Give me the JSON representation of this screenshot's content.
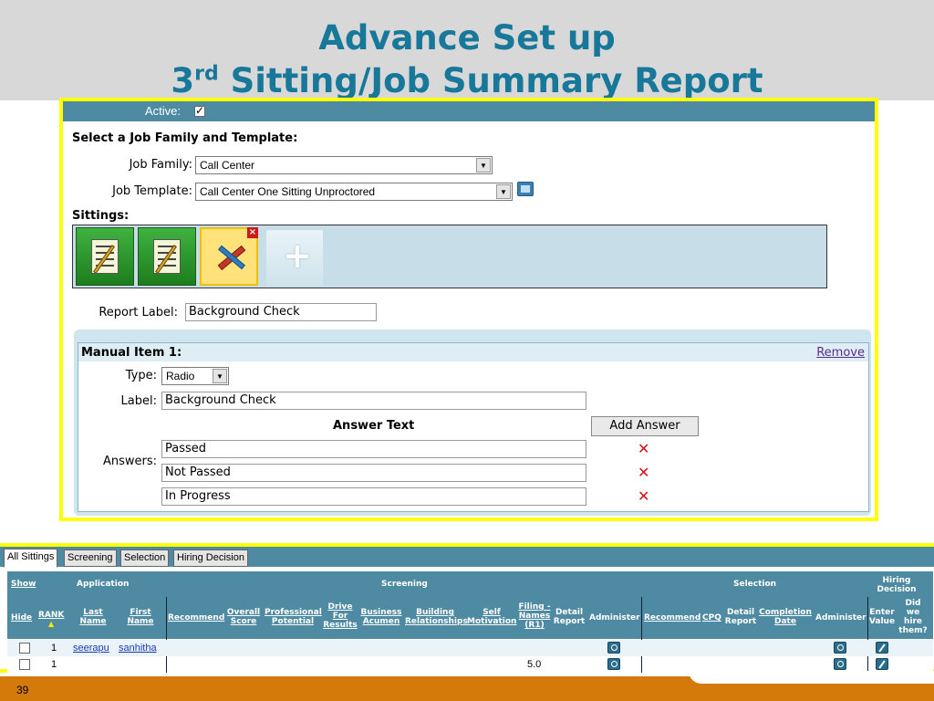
{
  "slide": {
    "title_line1": "Advance Set up",
    "title_line2_num": "3",
    "title_line2_sup": "rd",
    "title_line2_rest": " Sitting/Job Summary Report",
    "page_number": "39"
  },
  "setup": {
    "active_label": "Active:",
    "active_checked": true,
    "select_heading": "Select a Job Family and Template:",
    "job_family_label": "Job Family:",
    "job_family_value": "Call Center",
    "job_template_label": "Job Template:",
    "job_template_value": "Call Center One Sitting Unproctored",
    "sittings_label": "Sittings:",
    "report_label_label": "Report Label:",
    "report_label_value": "Background Check"
  },
  "sittings": [
    {
      "icon": "checklist-icon",
      "selected": false
    },
    {
      "icon": "checklist-icon",
      "selected": false
    },
    {
      "icon": "tools-icon",
      "selected": true
    },
    {
      "icon": "add-icon",
      "selected": false
    }
  ],
  "manual_item": {
    "heading": "Manual Item 1:",
    "remove": "Remove",
    "type_label": "Type:",
    "type_value": "Radio",
    "label_label": "Label:",
    "label_value": "Background Check",
    "answer_text_header": "Answer Text",
    "add_answer": "Add Answer",
    "answers_label": "Answers:",
    "answers": [
      "Passed",
      "Not Passed",
      "In Progress"
    ]
  },
  "grid": {
    "tabs": [
      "All Sittings",
      "Screening",
      "Selection",
      "Hiring Decision"
    ],
    "groups": {
      "show": "Show",
      "application": "Application",
      "screening": "Screening",
      "selection": "Selection",
      "hiring": "Hiring Decision"
    },
    "columns": {
      "hide": "Hide",
      "rank": "RANK",
      "last_name": "Last Name",
      "first_name": "First Name",
      "recommend": "Recommend",
      "overall_score": "Overall Score",
      "professional_potential": "Professional Potential",
      "drive_for_results": "Drive For Results",
      "business_acumen": "Business Acumen",
      "building_relationships": "Building Relationships",
      "self_motivation": "Self Motivation",
      "filing_names": "Filing - Names (R1)",
      "detail_report": "Detail Report",
      "administer": "Administer",
      "sel_recommend": "Recommend",
      "cpq": "CPQ",
      "sel_detail_report": "Detail Report",
      "completion_date": "Completion Date",
      "sel_administer": "Administer",
      "enter_value": "Enter Value",
      "did_we_hire": "Did we hire them?"
    },
    "rows": [
      {
        "rank": "1",
        "last": "seerapu",
        "first": "sanhitha",
        "filing": ""
      },
      {
        "rank": "1",
        "last": "",
        "first": "",
        "filing": "5.0"
      }
    ]
  }
}
